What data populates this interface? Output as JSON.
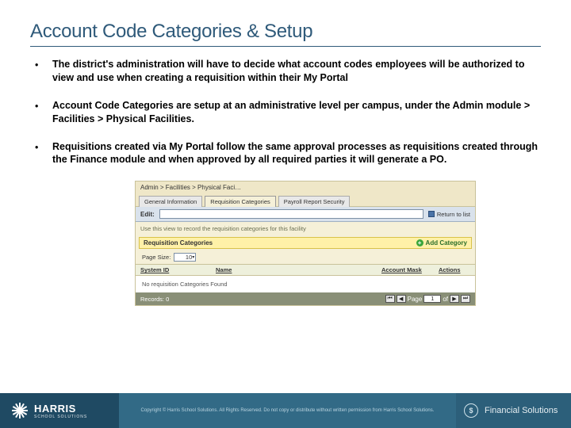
{
  "title": "Account Code Categories & Setup",
  "bullets": [
    "The district's administration will have to decide what account codes employees will be authorized to view and use when creating a requisition within their My Portal",
    "Account Code Categories are setup at an administrative level per campus, under the Admin module > Facilities > Physical Facilities.",
    "Requisitions created via My Portal follow the same approval processes as requisitions created through the Finance module and when approved by all required parties it will generate a PO."
  ],
  "screenshot": {
    "breadcrumb": "Admin > Facilities > Physical Faci…",
    "tabs": {
      "general": "General Information",
      "req": "Requisition Categories",
      "payroll": "Payroll Report Security"
    },
    "edit_label": "Edit:",
    "return_label": "Return to list",
    "hint": "Use this view to record the requisition categories for this facility",
    "cat_header": "Requisition Categories",
    "add_category": "Add Category",
    "page_size_label": "Page Size:",
    "page_size_value": "10",
    "columns": {
      "system_id": "System ID",
      "name": "Name",
      "account_mask": "Account Mask",
      "actions": "Actions"
    },
    "empty": "No requisition Categories Found",
    "records_label": "Records: 0",
    "page_label": "Page",
    "page_value": "1",
    "page_of": "of"
  },
  "footer": {
    "brand": "HARRIS",
    "brand_sub": "SCHOOL SOLUTIONS",
    "copyright": "Copyright © Harris School Solutions. All Rights Reserved. Do not copy or distribute without written permission from Harris School Solutions.",
    "product_glyph": "$",
    "product": "Financial Solutions"
  }
}
